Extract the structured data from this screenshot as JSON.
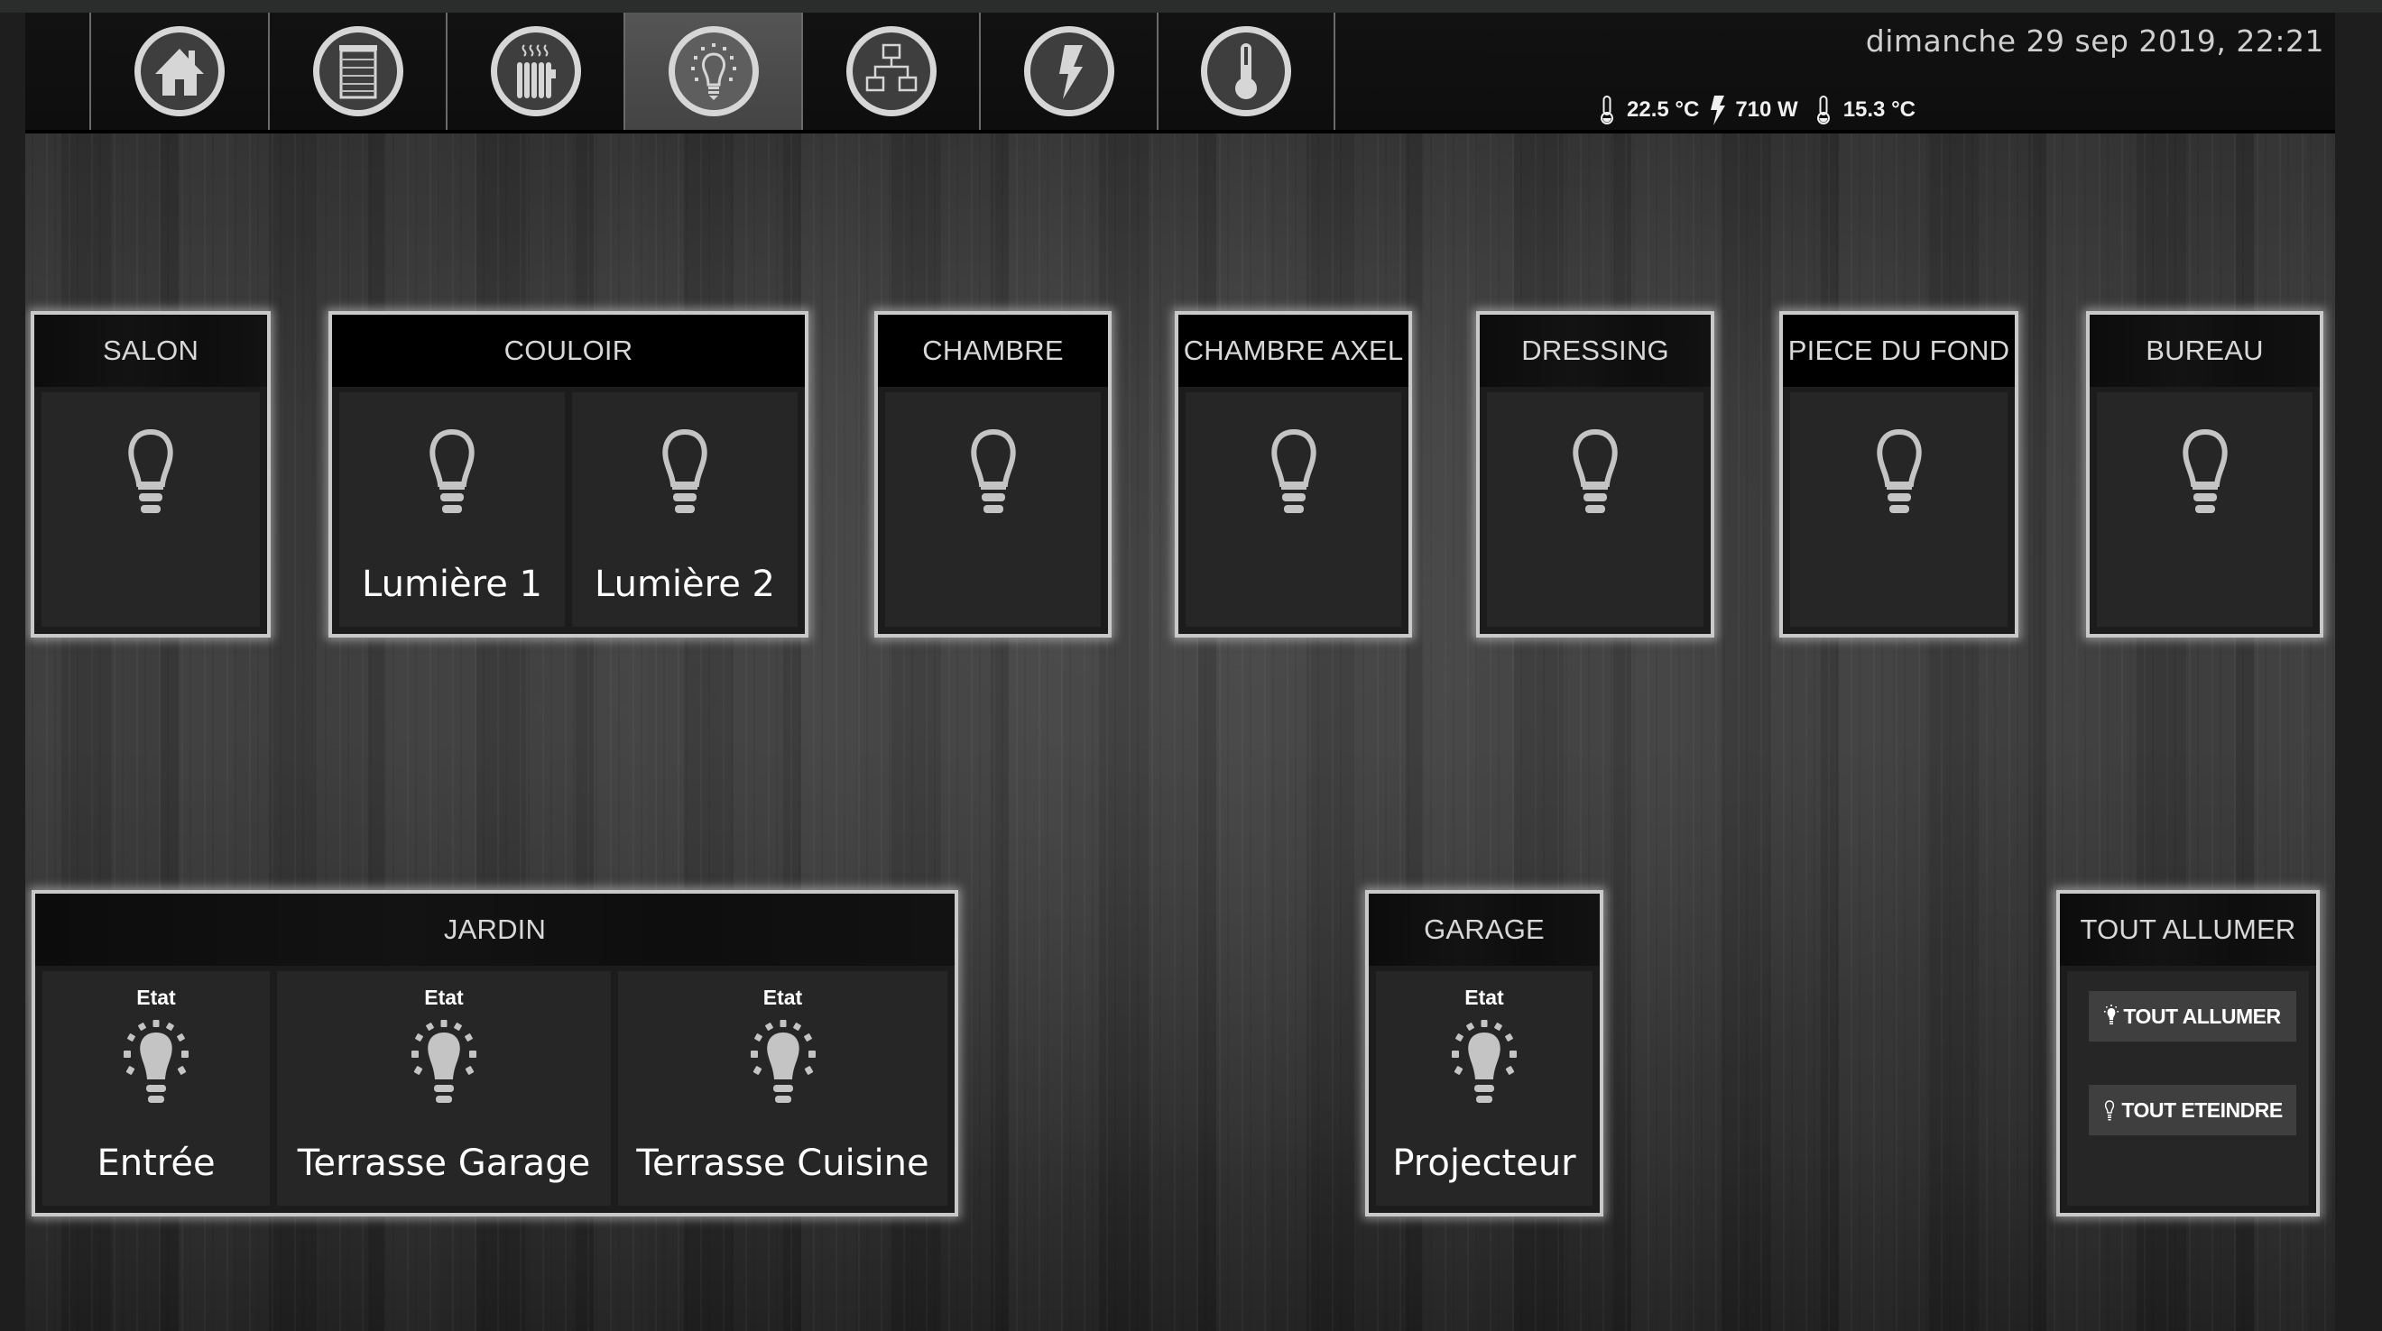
{
  "header": {
    "datetime": "dimanche 29 sep 2019, 22:21",
    "status": [
      {
        "icon": "thermometer-icon",
        "value": "22.5 °C"
      },
      {
        "icon": "lightning-icon",
        "value": "710 W"
      },
      {
        "icon": "thermometer-icon",
        "value": "15.3 °C"
      }
    ]
  },
  "nav": {
    "active_index": 3,
    "items": [
      {
        "name": "home",
        "icon": "home-icon"
      },
      {
        "name": "shutters",
        "icon": "shutter-icon"
      },
      {
        "name": "heating",
        "icon": "radiator-icon"
      },
      {
        "name": "lights",
        "icon": "lightbulb-icon"
      },
      {
        "name": "network",
        "icon": "network-icon"
      },
      {
        "name": "energy",
        "icon": "lightning-icon"
      },
      {
        "name": "temperature",
        "icon": "thermometer-icon"
      }
    ]
  },
  "rooms": {
    "salon": {
      "title": "SALON",
      "tiles": [
        {
          "label": "",
          "state": "off"
        }
      ]
    },
    "couloir": {
      "title": "COULOIR",
      "tiles": [
        {
          "label": "Lumière 1",
          "state": "off"
        },
        {
          "label": "Lumière 2",
          "state": "off"
        }
      ]
    },
    "chambre": {
      "title": "CHAMBRE",
      "tiles": [
        {
          "label": "",
          "state": "off"
        }
      ]
    },
    "chambre_axel": {
      "title": "CHAMBRE AXEL",
      "tiles": [
        {
          "label": "",
          "state": "off"
        }
      ]
    },
    "dressing": {
      "title": "DRESSING",
      "tiles": [
        {
          "label": "",
          "state": "off"
        }
      ]
    },
    "piece_du_fond": {
      "title": "PIECE DU FOND",
      "tiles": [
        {
          "label": "",
          "state": "off"
        }
      ]
    },
    "bureau": {
      "title": "BUREAU",
      "tiles": [
        {
          "label": "",
          "state": "off"
        }
      ]
    },
    "jardin": {
      "title": "JARDIN",
      "tiles": [
        {
          "state_label": "Etat",
          "label": "Entrée",
          "state": "on"
        },
        {
          "state_label": "Etat",
          "label": "Terrasse Garage",
          "state": "on"
        },
        {
          "state_label": "Etat",
          "label": "Terrasse Cuisine",
          "state": "on"
        }
      ]
    },
    "garage": {
      "title": "GARAGE",
      "tiles": [
        {
          "state_label": "Etat",
          "label": "Projecteur",
          "state": "on"
        }
      ]
    }
  },
  "all_lights": {
    "title": "TOUT ALLUMER",
    "on_button": "TOUT ALLUMER",
    "off_button": "TOUT ETEINDRE"
  },
  "colors": {
    "card_border": "#c9c9c9",
    "tile_bg": "#262626",
    "icon_gray": "#c4c4c4",
    "button_bg": "#3f3f3f"
  }
}
